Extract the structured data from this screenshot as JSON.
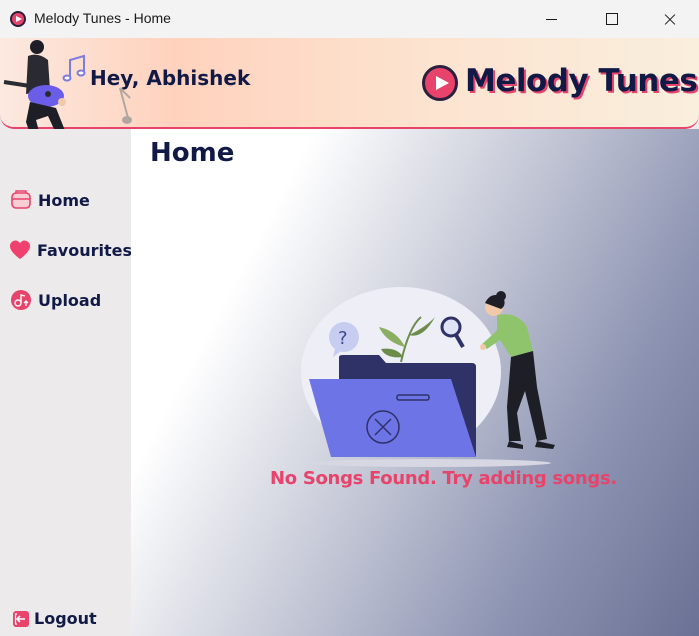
{
  "window": {
    "title": "Melody Tunes - Home"
  },
  "header": {
    "greeting": "Hey, Abhishek",
    "brand": "Melody Tunes"
  },
  "sidebar": {
    "items": [
      {
        "label": "Home",
        "icon": "home-icon"
      },
      {
        "label": "Favourites",
        "icon": "heart-icon"
      },
      {
        "label": "Upload",
        "icon": "upload-icon"
      }
    ],
    "logout": {
      "label": "Logout",
      "icon": "logout-icon"
    }
  },
  "main": {
    "title": "Home",
    "empty_message": "No Songs Found. Try adding songs."
  },
  "colors": {
    "accent": "#e8436b",
    "navy": "#111a46",
    "sidebar_bg": "#eceaea"
  }
}
